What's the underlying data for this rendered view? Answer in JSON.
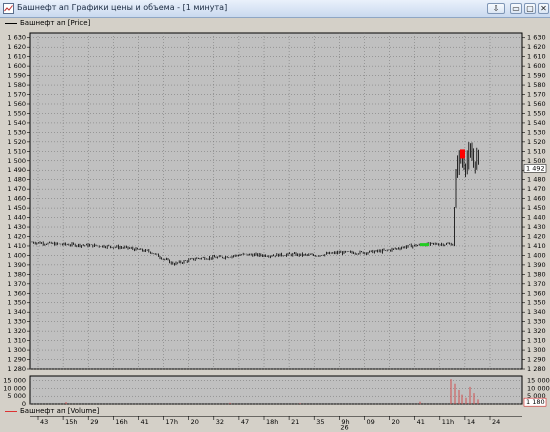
{
  "window": {
    "title": "Башнефт ап Графики цены и объема - [1 минута]",
    "buttons": {
      "pin": "⇩",
      "minimize": "▭",
      "restore": "▭",
      "close": "✕"
    }
  },
  "price_legend": "Башнефт ап [Price]",
  "volume_legend": "Башнефт ап [Volume]",
  "price_axis_labels": [
    "1 630",
    "1 620",
    "1 610",
    "1 600",
    "1 590",
    "1 580",
    "1 570",
    "1 560",
    "1 550",
    "1 540",
    "1 530",
    "1 520",
    "1 510",
    "1 500",
    "1 490",
    "1 480",
    "1 470",
    "1 460",
    "1 450",
    "1 440",
    "1 430",
    "1 420",
    "1 410",
    "1 400",
    "1 390",
    "1 380",
    "1 370",
    "1 360",
    "1 350",
    "1 340",
    "1 330",
    "1 320",
    "1 310",
    "1 300",
    "1 290",
    "1 280"
  ],
  "current_price_label": "1 492",
  "volume_axis_labels": [
    "15 000",
    "10 000",
    "5 000",
    "0"
  ],
  "current_volume_label": "1 180",
  "time_labels": [
    "43",
    "15h",
    "29",
    "16h",
    "41",
    "17h",
    "20",
    "32",
    "47",
    "18h",
    "21",
    "35",
    "9h",
    "09",
    "20",
    "41",
    "11h",
    "14",
    "24"
  ],
  "time_sublabel": "26",
  "colors": {
    "background": "#d4d0c8",
    "panel": "#c0c0c0",
    "candle": "#000000",
    "bull": "#22cc22",
    "bear": "#ff0000",
    "volume": "#d05050"
  },
  "chart_data": {
    "type": "candlestick",
    "title": "",
    "ylabel": "",
    "ylim": [
      1280,
      1635
    ],
    "x": [
      "43",
      "15h",
      "29",
      "16h",
      "41",
      "17h",
      "20",
      "32",
      "47",
      "18h",
      "21",
      "35",
      "9h",
      "09",
      "20",
      "41",
      "11h",
      "14",
      "24"
    ],
    "price_series": [
      {
        "segment": "43–15h",
        "close": 1414
      },
      {
        "segment": "15h–29",
        "close": 1412
      },
      {
        "segment": "29–16h",
        "close": 1411
      },
      {
        "segment": "16h–41",
        "close": 1410
      },
      {
        "segment": "41–17h",
        "close": 1408
      },
      {
        "segment": "17h–20",
        "close": 1404
      },
      {
        "segment": "20",
        "close": 1391
      },
      {
        "segment": "20–32",
        "close": 1397
      },
      {
        "segment": "32–47",
        "close": 1398
      },
      {
        "segment": "47–18h",
        "close": 1401
      },
      {
        "segment": "18h–21",
        "close": 1400
      },
      {
        "segment": "21–35",
        "close": 1401
      },
      {
        "segment": "35–9h",
        "close": 1400
      },
      {
        "segment": "9h–09",
        "close": 1403
      },
      {
        "segment": "09–20",
        "close": 1403
      },
      {
        "segment": "20–41",
        "close": 1405
      },
      {
        "segment": "41–11h",
        "close": 1410
      },
      {
        "segment": "11h–14",
        "close": 1412
      },
      {
        "segment": "14",
        "close": 1500
      },
      {
        "segment": "14–24",
        "close": 1492
      }
    ],
    "last_price": 1492,
    "volume_ylim": [
      0,
      18000
    ],
    "last_volume": 1180
  }
}
